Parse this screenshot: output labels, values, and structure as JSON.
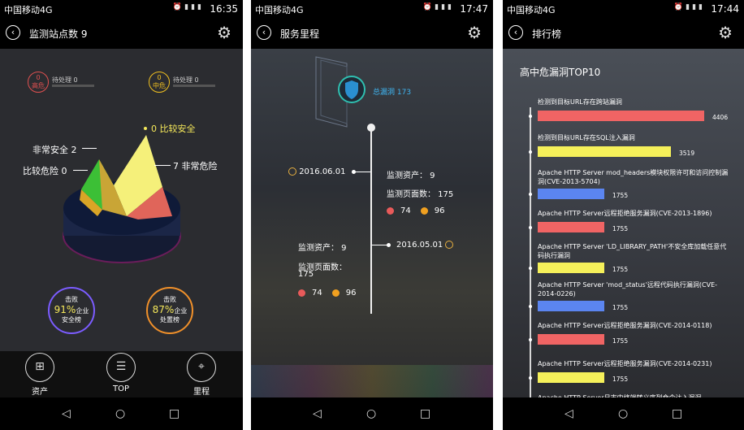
{
  "screens": [
    {
      "status": {
        "carrier": "中国移动4G",
        "time": "16:35"
      },
      "title": "监测站点数 9",
      "risks": [
        {
          "count": "0",
          "level": "高危",
          "pending": "待处理 0",
          "color": "#e05050"
        },
        {
          "count": "0",
          "level": "中危",
          "pending": "待处理 0",
          "color": "#f0c020"
        }
      ],
      "pie_labels": {
        "safe": "0 比较安全",
        "very_safe": "非常安全 2",
        "danger": "比较危险 0",
        "very_danger": "7 非常危险"
      },
      "rings": [
        {
          "top": "击败",
          "pct": "91%",
          "unit": "企业",
          "sub": "安全榜",
          "color": "#7b5cff"
        },
        {
          "top": "击败",
          "pct": "87%",
          "unit": "企业",
          "sub": "处置榜",
          "color": "#f0902a"
        }
      ],
      "tabs": [
        {
          "label": "资产",
          "icon": "network-icon"
        },
        {
          "label": "TOP",
          "icon": "list-icon"
        },
        {
          "label": "里程",
          "icon": "map-pin-icon"
        }
      ]
    },
    {
      "status": {
        "carrier": "中国移动4G",
        "time": "17:47"
      },
      "title": "服务里程",
      "total": "总漏洞 173",
      "entries": [
        {
          "date": "2016.06.01",
          "assets": "监测资产：  9",
          "pages": "监测页面数：  175",
          "up": "74",
          "down": "96"
        },
        {
          "date": "2016.05.01",
          "assets": "监测资产：  9",
          "pages_line1": "监测页面数：",
          "pages_line2": "175",
          "up": "74",
          "down": "96"
        }
      ]
    },
    {
      "status": {
        "carrier": "中国移动4G",
        "time": "17:44"
      },
      "title": "排行榜",
      "heading": "高中危漏洞TOP10",
      "items": [
        {
          "name": "检测到目标URL存在跨站漏洞",
          "value": "4406",
          "num": 4406,
          "color": "#f06464"
        },
        {
          "name": "检测到目标URL存在SQL注入漏洞",
          "value": "3519",
          "num": 3519,
          "color": "#f5f05a"
        },
        {
          "name": "Apache HTTP Server mod_headers模块权限许可和访问控制漏洞(CVE-2013-5704)",
          "value": "1755",
          "num": 1755,
          "color": "#5b85f0"
        },
        {
          "name": "Apache HTTP Server远程拒绝服务漏洞(CVE-2013-1896)",
          "value": "1755",
          "num": 1755,
          "color": "#f06464"
        },
        {
          "name": "Apache HTTP Server 'LD_LIBRARY_PATH'不安全库加载任意代码执行漏洞",
          "value": "1755",
          "num": 1755,
          "color": "#f5f05a"
        },
        {
          "name": "Apache HTTP Server 'mod_status'远程代码执行漏洞(CVE-2014-0226)",
          "value": "1755",
          "num": 1755,
          "color": "#5b85f0"
        },
        {
          "name": "Apache HTTP Server远程拒绝服务漏洞(CVE-2014-0118)",
          "value": "1755",
          "num": 1755,
          "color": "#f06464"
        },
        {
          "name": "Apache HTTP Server远程拒绝服务漏洞(CVE-2014-0231)",
          "value": "1755",
          "num": 1755,
          "color": "#f5f05a"
        },
        {
          "name": "Apache HTTP Server日志中终端转义序列命令注入漏洞",
          "value": "",
          "num": 0,
          "color": "#f5f05a"
        }
      ]
    }
  ],
  "nav": {
    "back": "◁",
    "home": "○",
    "recent": "□"
  }
}
